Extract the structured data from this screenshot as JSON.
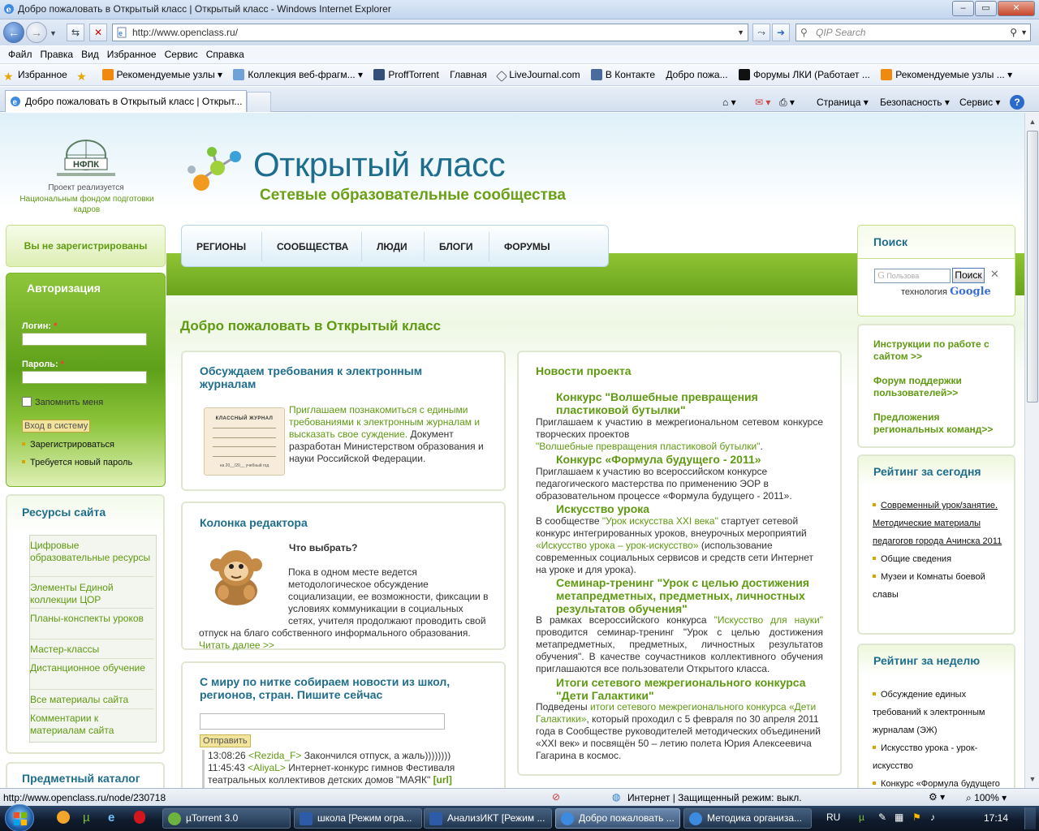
{
  "window": {
    "title": "Добро пожаловать в Открытый класс | Открытый класс - Windows Internet Explorer"
  },
  "address": {
    "url": "http://www.openclass.ru/",
    "search_placeholder": "QIP Search"
  },
  "menu": [
    "Файл",
    "Правка",
    "Вид",
    "Избранное",
    "Сервис",
    "Справка"
  ],
  "favorites": {
    "label": "Избранное",
    "items": [
      "Рекомендуемые узлы",
      "Коллекция веб-фрагм...",
      "ProffTorrent",
      "Главная",
      "LiveJournal.com",
      "В Контакте",
      "Добро пожа...",
      "Форумы ЛКИ (Работает ...",
      "Рекомендуемые узлы ..."
    ]
  },
  "tab": {
    "title": "Добро пожаловать в Открытый класс | Открыт..."
  },
  "commands": {
    "page": "Страница",
    "security": "Безопасность",
    "service": "Сервис"
  },
  "site": {
    "nfpk": {
      "logo": "НФПК",
      "note1": "Проект реализуется",
      "note2": "Национальным фондом подготовки кадров"
    },
    "logo": {
      "title": "Открытый класс",
      "subtitle": "Сетевые образовательные сообщества"
    },
    "nav": [
      "РЕГИОНЫ",
      "СООБЩЕСТВА",
      "ЛЮДИ",
      "БЛОГИ",
      "ФОРУМЫ"
    ],
    "not_registered": "Вы не зарегистрированы",
    "auth": {
      "title": "Авторизация",
      "login_label": "Логин:",
      "password_label": "Пароль:",
      "required": "*",
      "remember": "Запомнить меня",
      "submit": "Вход в систему",
      "register": "Зарегистрироваться",
      "new_password": "Требуется новый пароль"
    },
    "resources": {
      "title": "Ресурсы сайта",
      "items": [
        "Цифровые образовательные ресурсы",
        "Элементы Единой коллекции ЦОР",
        "Планы-конспекты уроков",
        "Мастер-классы",
        "Дистанционное обучение",
        "Все материалы сайта",
        "Комментарии к материалам сайта"
      ]
    },
    "subject_catalog": "Предметный каталог",
    "welcome": "Добро пожаловать в Открытый класс",
    "block1": {
      "title": "Обсуждаем требования к электронным журналам",
      "journal_label": "КЛАССНЫЙ ЖУРНАЛ",
      "journal_year": "на 20__/20__ учебный год",
      "link": "Приглашаем познакомиться с едиными требованиями к электронным журналам и высказать свое суждение.",
      "text": "Документ разработан Министерством образования и науки Российской Федерации."
    },
    "block2": {
      "title": "Колонка редактора",
      "subtitle": "Что выбрать?",
      "text": "Пока в одном месте ведется методологическое обсуждение социализации, ее возможности, фиксации в условиях коммуникации в социальных сетях, учителя продолжают проводить свой отпуск на благо собственного информального образования.",
      "more": "Читать далее >>"
    },
    "block3": {
      "title": "С миру по нитке собираем новости из школ, регионов, стран. Пишите сейчас",
      "send": "Отправить",
      "chat": [
        {
          "time": "13:08:26",
          "user": "<Rezida_F>",
          "msg": "Закончился отпуск, а жаль))))))))"
        },
        {
          "time": "11:45:43",
          "user": "<AliyaL>",
          "msg": "Интернет-конкурс гимнов Фестиваля театральных коллективов детских домов \"МАЯК\"",
          "tag": "[url]"
        }
      ]
    },
    "news": {
      "title": "Новости проекта",
      "items": [
        {
          "h": "Конкурс \"Волшебные превращения пластиковой бутылки\"",
          "t": "Приглашаем к участию в межрегиональном сетевом конкурсе творческих проектов",
          "l": "\"Волшебные превращения пластиковой бутылки\"",
          "e": "."
        },
        {
          "h": "Конкурс «Формула будущего - 2011»",
          "t": "Приглашаем к участию во всероссийском конкурсе педагогического мастерства по применению ЭОР в образовательном процессе «Формула будущего - 2011»."
        },
        {
          "h": "Искусство урока",
          "t1": "В сообществе ",
          "l1": "\"Урок искусства XXI века\"",
          "t2": " стартует сетевой конкурс интегрированных уроков, внеурочных мероприятий ",
          "l2": "«Искусство урока – урок-искусство»",
          "t3": " (использование современных социальных сервисов и средств сети Интернет на уроке и для урока)."
        },
        {
          "h": "Семинар-тренинг \"Урок с целью достижения метапредметных, предметных, личностных результатов обучения\"",
          "t1": "В рамках всероссийского конкурса ",
          "l1": "\"Искусство для науки\"",
          "t2": " проводится семинар-тренинг \"Урок с целью достижения метапредметных, предметных, личностных результатов обучения\". В качестве соучастников коллективного обучения приглашаются все пользователи Открытого класса."
        },
        {
          "h": "Итоги сетевого межрегионального конкурса \"Дети Галактики\"",
          "t1": "Подведены ",
          "l1": "итоги сетевого межрегионального конкурса «Дети Галактики»",
          "t2": ",  который проходил с 5 февраля по 30 апреля 2011 года в Сообществе руководителей методических объединений «XXI век» и  посвящён  50 – летию полета Юрия Алексеевича Гагарина в космос."
        }
      ]
    },
    "search": {
      "title": "Поиск",
      "placeholder": "Пользова",
      "button": "Поиск",
      "tech": "технология",
      "google": "Google"
    },
    "links": [
      "Инструкции по работе с сайтом >>",
      "Форум поддержки пользователей>>",
      "Предложения региональных команд>>"
    ],
    "rating_today": {
      "title": "Рейтинг за сегодня",
      "items": [
        "Современный урок/занятие. Методические материалы педагогов города Ачинска 2011",
        "Общие сведения",
        "Музеи и Комнаты боевой славы"
      ]
    },
    "rating_week": {
      "title": "Рейтинг за неделю",
      "items": [
        "Обсуждение единых требований к электронным журналам (ЭЖ)",
        "Искусство урока - урок-искусство",
        "Конкурс «Формула будущего"
      ]
    }
  },
  "status": {
    "url": "http://www.openclass.ru/node/230718",
    "zone": "Интернет | Защищенный режим: выкл.",
    "zoom": "100%"
  },
  "taskbar": {
    "tasks": [
      "µTorrent 3.0",
      "школа [Режим огра...",
      "АнализИКТ [Режим ...",
      "Добро пожаловать ...",
      "Методика организа..."
    ],
    "lang": "RU",
    "clock": "17:14"
  }
}
